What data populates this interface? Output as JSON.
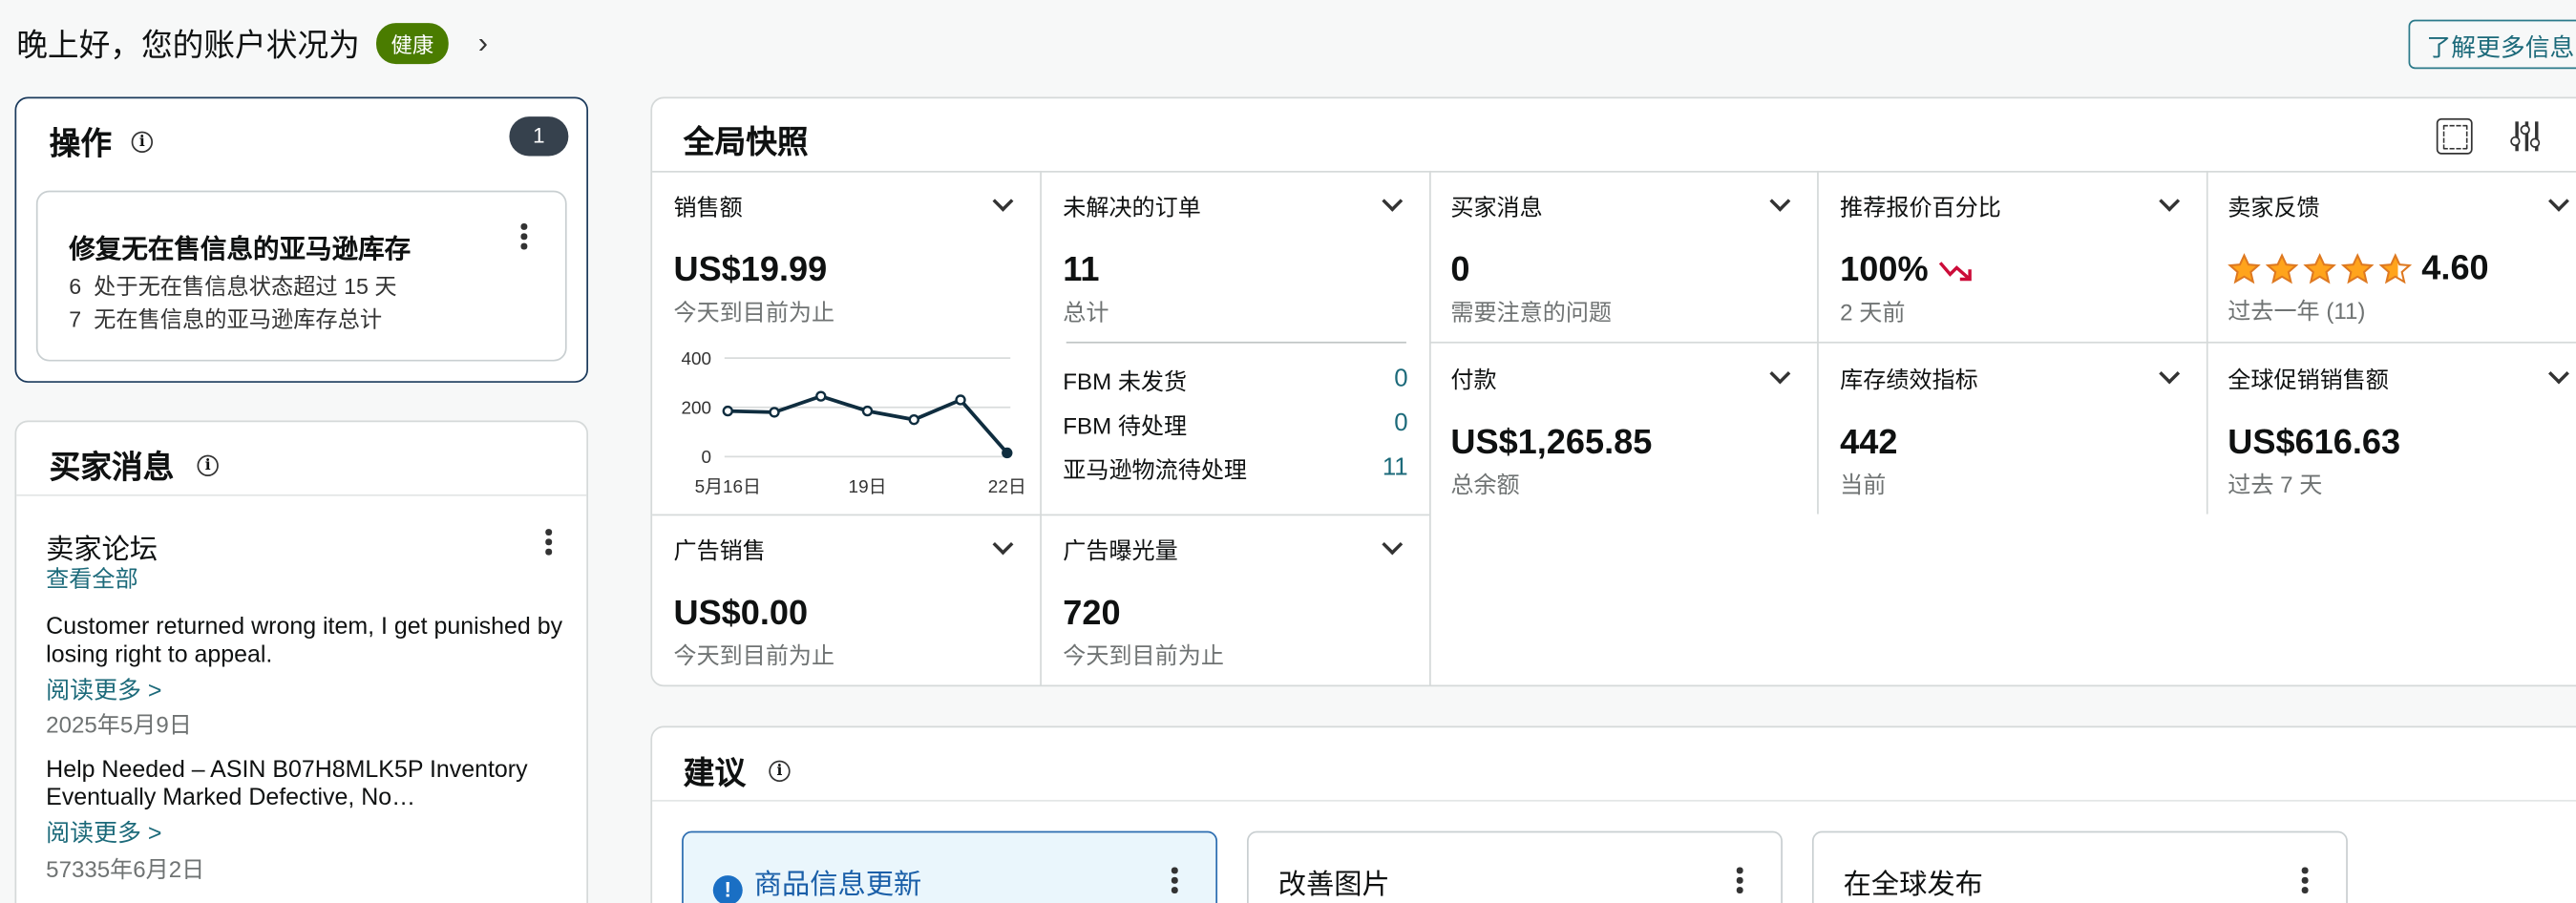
{
  "header": {
    "greeting": "晚上好，您的账户状况为",
    "health_badge": "健康",
    "learn_more": "了解更多信息"
  },
  "actions": {
    "title": "操作",
    "count": "1",
    "task": {
      "title": "修复无在售信息的亚马逊库存",
      "lines": [
        {
          "count": "6",
          "text": "处于无在售信息状态超过 15 天"
        },
        {
          "count": "7",
          "text": "无在售信息的亚马逊库存总计"
        }
      ]
    }
  },
  "buyer_messages": {
    "title": "买家消息",
    "forum_title": "卖家论坛",
    "view_all": "查看全部",
    "posts": [
      {
        "text": "Customer returned wrong item, I get punished by losing right to appeal.",
        "more": "阅读更多 >",
        "date": "2025年5月9日"
      },
      {
        "text": "Help Needed – ASIN B07H8MLK5P Inventory Eventually Marked Defective, No…",
        "more": "阅读更多 >",
        "date": "57335年6月2日"
      }
    ]
  },
  "snapshot": {
    "title": "全局快照",
    "tiles": {
      "sales": {
        "label": "销售额",
        "value": "US$19.99",
        "sub": "今天到目前为止"
      },
      "open_orders": {
        "label": "未解决的订单",
        "value": "11",
        "sub": "总计"
      },
      "buyer_msgs": {
        "label": "买家消息",
        "value": "0",
        "sub": "需要注意的问题"
      },
      "featured_offer": {
        "label": "推荐报价百分比",
        "value": "100%",
        "sub": "2 天前"
      },
      "feedback": {
        "label": "卖家反馈",
        "value": "4.60",
        "sub": "过去一年 (11)",
        "rating": 4.6
      },
      "payments": {
        "label": "付款",
        "value": "US$1,265.85",
        "sub": "总余额"
      },
      "inventory": {
        "label": "库存绩效指标",
        "value": "442",
        "sub": "当前"
      },
      "global_promo": {
        "label": "全球促销销售额",
        "value": "US$616.63",
        "sub": "过去 7 天"
      },
      "ad_sales": {
        "label": "广告销售",
        "value": "US$0.00",
        "sub": "今天到目前为止"
      },
      "ad_impressions": {
        "label": "广告曝光量",
        "value": "720",
        "sub": "今天到目前为止"
      }
    },
    "fbm": [
      {
        "label": "FBM 未发货",
        "value": "0"
      },
      {
        "label": "FBM 待处理",
        "value": "0"
      },
      {
        "label": "亚马逊物流待处理",
        "value": "11"
      }
    ]
  },
  "chart_data": {
    "type": "line",
    "x": [
      "5月16日",
      "5月17日",
      "5月18日",
      "5月19日",
      "5月20日",
      "5月21日",
      "5月22日"
    ],
    "y_ticks": [
      "400",
      "200",
      "0"
    ],
    "x_ticks": [
      "5月16日",
      "19日",
      "22日"
    ],
    "series": [
      {
        "values": [
          185,
          180,
          245,
          185,
          150,
          230,
          15
        ]
      }
    ],
    "ylim": [
      0,
      400
    ],
    "grid": true
  },
  "suggestions": {
    "title": "建议",
    "cards": [
      {
        "label": "商品信息更新",
        "active": true
      },
      {
        "label": "改善图片",
        "active": false
      },
      {
        "label": "在全球发布",
        "active": false
      }
    ]
  }
}
